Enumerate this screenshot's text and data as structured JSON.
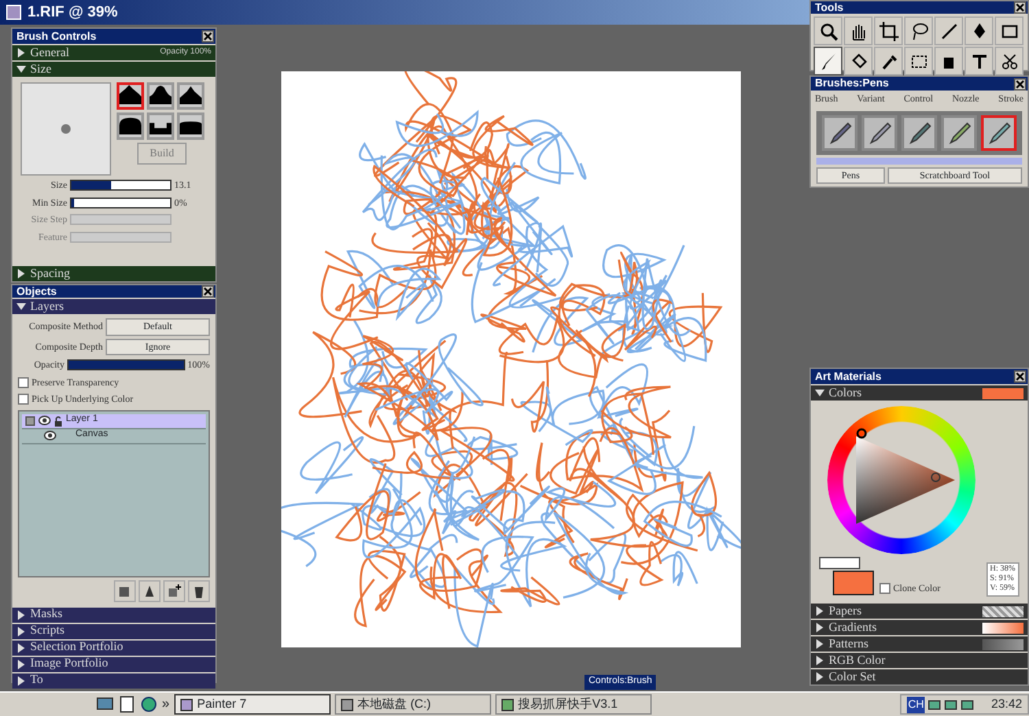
{
  "window": {
    "title": "1.RIF @ 39%"
  },
  "brush_controls": {
    "title": "Brush Controls",
    "general": {
      "label": "General",
      "expanded": false,
      "info": "Opacity 100%"
    },
    "size": {
      "label": "Size",
      "expanded": true,
      "profiles": [
        {
          "selected": true
        },
        {
          "selected": false
        },
        {
          "selected": false
        },
        {
          "selected": false
        },
        {
          "selected": false
        },
        {
          "selected": false
        }
      ],
      "build_button": {
        "label": "Build",
        "disabled": true
      },
      "sliders": [
        {
          "label": "Size",
          "disabled": false,
          "level": 0.4,
          "reading": "13.1"
        },
        {
          "label": "Min Size",
          "disabled": false,
          "level": 0.0,
          "reading": "0%"
        },
        {
          "label": "Size Step",
          "disabled": true
        },
        {
          "label": "Feature",
          "disabled": true
        }
      ]
    },
    "spacing": {
      "label": "Spacing",
      "expanded": false
    }
  },
  "objects": {
    "title": "Objects",
    "layers": {
      "label": "Layers",
      "expanded": true,
      "fields": [
        {
          "label": "Composite Method",
          "value": "Default"
        },
        {
          "label": "Composite Depth",
          "value": "Ignore"
        }
      ],
      "opacity": {
        "label": "Opacity",
        "level": 1.0,
        "reading": "100%"
      },
      "options": [
        {
          "label": "Preserve Transparency",
          "checked": false
        },
        {
          "label": "Pick Up Underlying Color",
          "checked": false
        }
      ],
      "layer_list": [
        {
          "name": "Layer 1",
          "selected": true,
          "kind": "layer"
        },
        {
          "name": "Canvas",
          "selected": false,
          "kind": "canvas"
        }
      ]
    },
    "sections": [
      {
        "label": "Masks",
        "expanded": false
      },
      {
        "label": "Scripts",
        "expanded": false
      },
      {
        "label": "Selection Portfolio",
        "expanded": false
      },
      {
        "label": "Image Portfolio",
        "expanded": false
      },
      {
        "label": "To",
        "expanded": false
      }
    ]
  },
  "tools": {
    "title": "Tools",
    "items": [
      {
        "selected": false
      },
      {
        "selected": false
      },
      {
        "selected": false
      },
      {
        "selected": false
      },
      {
        "selected": false
      },
      {
        "selected": false
      },
      {
        "selected": false
      },
      {
        "selected": true
      },
      {
        "selected": false
      },
      {
        "selected": false
      },
      {
        "selected": false
      },
      {
        "selected": false
      },
      {
        "selected": false
      },
      {
        "selected": false
      }
    ]
  },
  "brushes": {
    "title": "Brushes:Pens",
    "menu": [
      "Brush",
      "Variant",
      "Control",
      "Nozzle",
      "Stroke"
    ],
    "items": [
      {
        "selected": false
      },
      {
        "selected": false
      },
      {
        "selected": false
      },
      {
        "selected": false
      },
      {
        "selected": true
      }
    ],
    "category": "Pens",
    "variant": "Scratchboard Tool"
  },
  "art_materials": {
    "title": "Art Materials",
    "colors": {
      "label": "Colors",
      "expanded": true,
      "color": "#f57040",
      "hsv": [
        "H: 38%",
        "S: 91%",
        "V: 59%"
      ],
      "clone_color": {
        "label": "Clone Color",
        "checked": false
      }
    },
    "sections": [
      {
        "label": "Papers",
        "expanded": false,
        "kind": "papers"
      },
      {
        "label": "Gradients",
        "expanded": false,
        "kind": "gradients"
      },
      {
        "label": "Patterns",
        "expanded": false,
        "kind": "patterns"
      },
      {
        "label": "RGB Color",
        "expanded": false,
        "kind": "plain"
      },
      {
        "label": "Color Set",
        "expanded": false,
        "kind": "plain"
      }
    ]
  },
  "controls_tab": "Controls:Brush",
  "taskbar": {
    "overflow": "»",
    "buttons": [
      {
        "label": "Painter 7",
        "selected": true
      },
      {
        "label": "本地磁盘 (C:)",
        "selected": false
      },
      {
        "label": "搜易抓屏快手V3.1",
        "selected": false
      }
    ],
    "input_indicator": "CH",
    "clock": "23:42"
  }
}
